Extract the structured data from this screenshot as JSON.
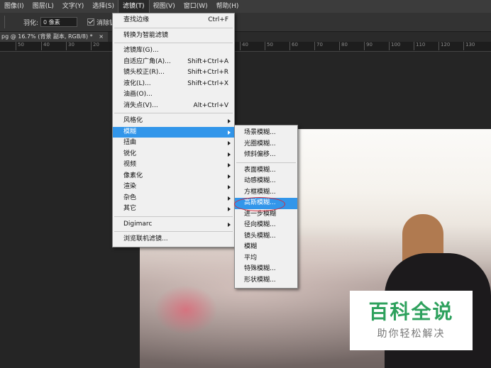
{
  "menubar": {
    "items": [
      {
        "label": "图像(I)"
      },
      {
        "label": "图层(L)"
      },
      {
        "label": "文字(Y)"
      },
      {
        "label": "选择(S)"
      },
      {
        "label": "滤镜(T)"
      },
      {
        "label": "视图(V)"
      },
      {
        "label": "窗口(W)"
      },
      {
        "label": "帮助(H)"
      }
    ]
  },
  "options": {
    "feather_label": "羽化:",
    "feather_value": "0 像素",
    "antialias_label": "消除锯齿"
  },
  "document_tab": {
    "title": "pg @ 16.7% (背景 副本, RGB/8) *",
    "close": "×"
  },
  "ruler": {
    "ticks": [
      "50",
      "40",
      "30",
      "20",
      "40",
      "50",
      "60",
      "70",
      "80",
      "90",
      "100",
      "110",
      "120",
      "130"
    ]
  },
  "filter_menu": {
    "group1": [
      {
        "label": "查找边缘",
        "shortcut": "Ctrl+F"
      }
    ],
    "group2": [
      {
        "label": "转换为智能滤镜"
      }
    ],
    "group3": [
      {
        "label": "滤镜库(G)..."
      },
      {
        "label": "自适应广角(A)...",
        "shortcut": "Shift+Ctrl+A"
      },
      {
        "label": "镜头校正(R)...",
        "shortcut": "Shift+Ctrl+R"
      },
      {
        "label": "液化(L)...",
        "shortcut": "Shift+Ctrl+X"
      },
      {
        "label": "油画(O)..."
      },
      {
        "label": "消失点(V)...",
        "shortcut": "Alt+Ctrl+V"
      }
    ],
    "group4": [
      {
        "label": "风格化"
      },
      {
        "label": "模糊"
      },
      {
        "label": "扭曲"
      },
      {
        "label": "锐化"
      },
      {
        "label": "视频"
      },
      {
        "label": "像素化"
      },
      {
        "label": "渲染"
      },
      {
        "label": "杂色"
      },
      {
        "label": "其它"
      }
    ],
    "group5": [
      {
        "label": "Digimarc"
      }
    ],
    "group6": [
      {
        "label": "浏览联机滤镜..."
      }
    ]
  },
  "blur_menu": {
    "group1": [
      {
        "label": "场景模糊..."
      },
      {
        "label": "光圈模糊..."
      },
      {
        "label": "倾斜偏移..."
      }
    ],
    "group2": [
      {
        "label": "表面模糊..."
      },
      {
        "label": "动感模糊..."
      },
      {
        "label": "方框模糊..."
      },
      {
        "label": "高斯模糊..."
      },
      {
        "label": "进一步模糊"
      },
      {
        "label": "径向模糊..."
      },
      {
        "label": "镜头模糊..."
      },
      {
        "label": "模糊"
      },
      {
        "label": "平均"
      },
      {
        "label": "特殊模糊..."
      },
      {
        "label": "形状模糊..."
      }
    ]
  },
  "watermark": {
    "title": "百科全说",
    "subtitle": "助你轻松解决"
  },
  "colors": {
    "highlight": "#3296ea",
    "annotation": "#d42a3c",
    "watermark_green": "#2ea15d"
  }
}
